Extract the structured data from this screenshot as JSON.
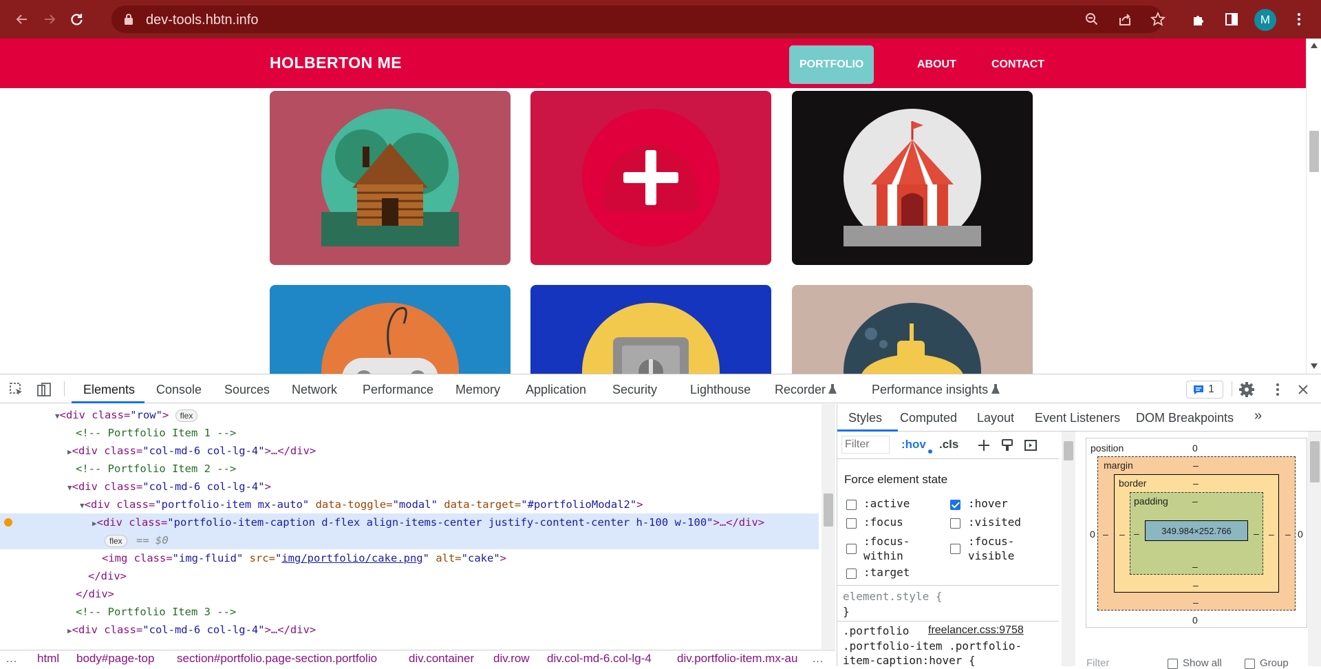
{
  "browser": {
    "url": "dev-tools.hbtn.info",
    "avatar_initial": "M",
    "icons": [
      "back-icon",
      "forward-icon",
      "reload-icon",
      "lock-icon",
      "zoom-icon",
      "share-icon",
      "star-icon",
      "extensions-icon",
      "sidepanel-icon",
      "menu-icon"
    ]
  },
  "site": {
    "brand": "HOLBERTON ME",
    "nav": [
      {
        "label": "PORTFOLIO",
        "active": true
      },
      {
        "label": "ABOUT",
        "active": false
      },
      {
        "label": "CONTACT",
        "active": false
      }
    ],
    "colors": {
      "navbar": "#e0003c",
      "active_nav": "#76cbcb"
    },
    "portfolio_items": [
      {
        "name": "cabin",
        "bg": "#b64e62",
        "circle": "#47b89b"
      },
      {
        "name": "cake",
        "bg": "#cc1544",
        "circle": "#e0003c"
      },
      {
        "name": "circus",
        "bg": "#121010",
        "circle": "#e6e6e6"
      },
      {
        "name": "game",
        "bg": "#1f87c6",
        "circle": "#e57a3b"
      },
      {
        "name": "safe",
        "bg": "#1535be",
        "circle": "#f2c94c"
      },
      {
        "name": "submarine",
        "bg": "#cab2a6",
        "circle": "#2f4858"
      }
    ]
  },
  "devtools": {
    "tabs": [
      "Elements",
      "Console",
      "Sources",
      "Network",
      "Performance",
      "Memory",
      "Application",
      "Security",
      "Lighthouse",
      "Recorder",
      "Performance insights"
    ],
    "active_tab": "Elements",
    "issues_count": "1",
    "dom": {
      "l1_tag": "<div class=",
      "l1_val": "\"row\"",
      "l1_end": ">",
      "flex": "flex",
      "c1": "<!-- Portfolio Item 1 -->",
      "collapsed_div_start": "<div class=",
      "col_val": "\"col-md-6 col-lg-4\"",
      "collapsed_div_end": ">…</div>",
      "c2": "<!-- Portfolio Item 2 -->",
      "open_div_end": ">",
      "item_tag": "<div class=",
      "item_val": "\"portfolio-item mx-auto\"",
      "toggle_attr": " data-toggle=",
      "toggle_val": "\"modal\"",
      "target_attr": " data-target=",
      "target_val": "\"#portfolioModal2\"",
      "caption_val": "\"portfolio-item-caption d-flex align-items-center justify-content-center h-100 w-100\"",
      "selected_marker": "== $0",
      "img_tag": "<img class=",
      "img_class": "\"img-fluid\"",
      "src_attr": " src=",
      "src_val": "img/portfolio/cake.png",
      "alt_attr": " alt=",
      "alt_val": "\"cake\"",
      "close_div": "</div>",
      "c3": "<!-- Portfolio Item 3 -->"
    },
    "breadcrumbs": [
      "html",
      "body#page-top",
      "section#portfolio.page-section.portfolio",
      "div.container",
      "div.row",
      "div.col-md-6.col-lg-4",
      "div.portfolio-item.mx-au"
    ],
    "styles_tabs": [
      "Styles",
      "Computed",
      "Layout",
      "Event Listeners",
      "DOM Breakpoints"
    ],
    "filter_placeholder": "Filter",
    "hov": ":hov",
    "cls": ".cls",
    "force_state_title": "Force element state",
    "states": [
      {
        "label": ":active",
        "checked": false
      },
      {
        "label": ":hover",
        "checked": true
      },
      {
        "label": ":focus",
        "checked": false
      },
      {
        "label": ":visited",
        "checked": false
      },
      {
        "label": ":focus-within",
        "checked": false
      },
      {
        "label": ":focus-visible",
        "checked": false
      },
      {
        "label": ":target",
        "checked": false
      }
    ],
    "element_style": "element.style {",
    "close_brace": "}",
    "rule_selector1": ".portfolio",
    "rule_source": "freelancer.css:9758",
    "rule_selector2": ".portfolio-item .portfolio-",
    "rule_selector3": "item-caption:hover {",
    "box_model": {
      "position_label": "position",
      "position_value": "0",
      "margin_label": "margin",
      "border_label": "border",
      "padding_label": "padding",
      "dash": "–",
      "zero": "0",
      "content": "349.984×252.766"
    },
    "bottom_filter": "Filter",
    "show_all": "Show all",
    "group": "Group"
  }
}
